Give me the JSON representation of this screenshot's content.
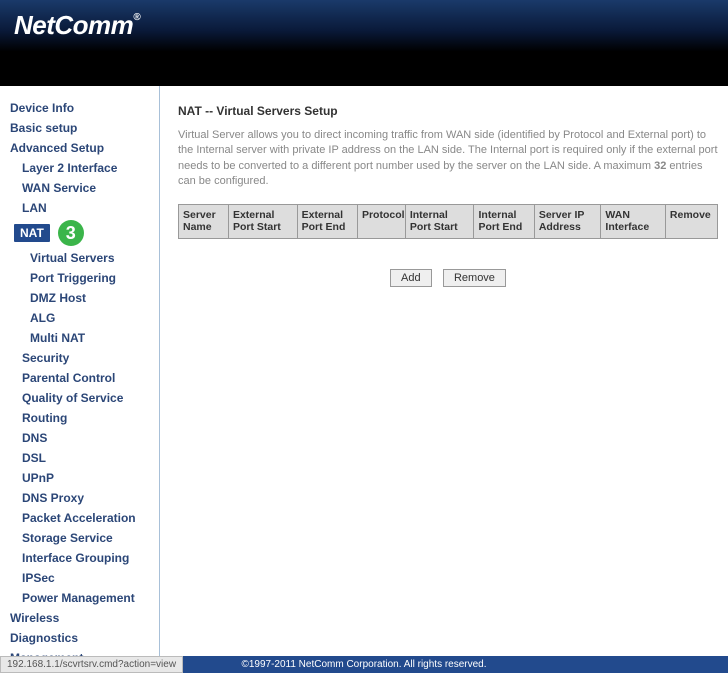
{
  "brand": "NetComm",
  "nav": {
    "device_info": "Device Info",
    "basic_setup": "Basic setup",
    "advanced_setup": "Advanced Setup",
    "layer2": "Layer 2 Interface",
    "wan_service": "WAN Service",
    "lan": "LAN",
    "nat": "NAT",
    "virtual_servers": "Virtual Servers",
    "port_triggering": "Port Triggering",
    "dmz_host": "DMZ Host",
    "alg": "ALG",
    "multi_nat": "Multi NAT",
    "security": "Security",
    "parental_control": "Parental Control",
    "qos": "Quality of Service",
    "routing": "Routing",
    "dns": "DNS",
    "dsl": "DSL",
    "upnp": "UPnP",
    "dns_proxy": "DNS Proxy",
    "packet_accel": "Packet Acceleration",
    "storage_service": "Storage Service",
    "interface_grouping": "Interface Grouping",
    "ipsec": "IPSec",
    "power_mgmt": "Power Management",
    "wireless": "Wireless",
    "diagnostics": "Diagnostics",
    "management": "Management"
  },
  "step_badge": "3",
  "page": {
    "title": "NAT -- Virtual Servers Setup",
    "desc_pre": "Virtual Server allows you to direct incoming traffic from WAN side (identified by Protocol and External port) to the Internal server with private IP address on the LAN side. The Internal port is required only if the external port needs to be converted to a different port number used by the server on the LAN side. A maximum ",
    "desc_count": "32",
    "desc_post": " entries can be configured."
  },
  "table": {
    "headers": {
      "server_name": "Server Name",
      "ext_port_start": "External Port Start",
      "ext_port_end": "External Port End",
      "protocol": "Protocol",
      "int_port_start": "Internal Port Start",
      "int_port_end": "Internal Port End",
      "server_ip": "Server IP Address",
      "wan_if": "WAN Interface",
      "remove": "Remove"
    }
  },
  "buttons": {
    "add": "Add",
    "remove": "Remove"
  },
  "footer": "©1997-2011 NetComm Corporation. All rights reserved.",
  "status_url": "192.168.1.1/scvrtsrv.cmd?action=view"
}
